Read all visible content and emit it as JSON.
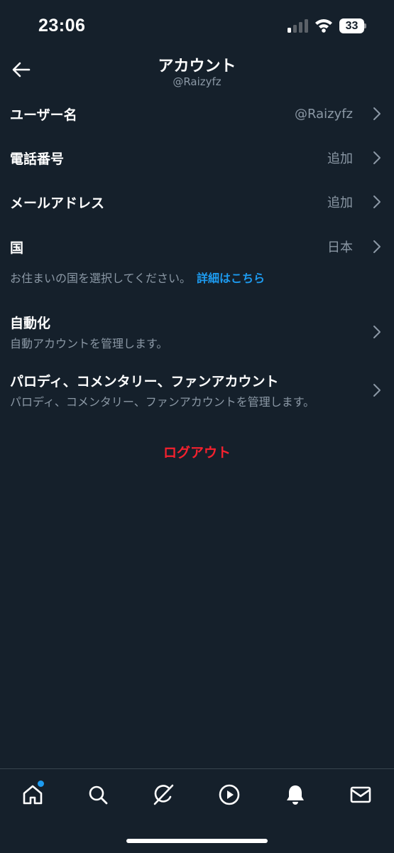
{
  "status_bar": {
    "time": "23:06",
    "battery_level": "33",
    "icons": [
      "signal-icon",
      "wifi-icon",
      "battery-icon"
    ]
  },
  "header": {
    "title": "アカウント",
    "subtitle": "@Raizyfz",
    "back_icon": "arrow-left-icon"
  },
  "rows": {
    "username": {
      "label": "ユーザー名",
      "value": "@Raizyfz"
    },
    "phone": {
      "label": "電話番号",
      "value": "追加"
    },
    "email": {
      "label": "メールアドレス",
      "value": "追加"
    },
    "country": {
      "label": "国",
      "value": "日本"
    }
  },
  "country_note": {
    "text": "お住まいの国を選択してください。",
    "link": "詳細はこちら"
  },
  "automation": {
    "title": "自動化",
    "description": "自動アカウントを管理します。"
  },
  "parody": {
    "title": "パロディ、コメンタリー、ファンアカウント",
    "description": "パロディ、コメンタリー、ファンアカウントを管理します。"
  },
  "logout_label": "ログアウト",
  "colors": {
    "background": "#15202b",
    "secondary_text": "#8b98a5",
    "link": "#1d9bf0",
    "danger": "#f4212e"
  },
  "bottom_nav": {
    "items": [
      "home-icon",
      "search-icon",
      "grok-icon",
      "play-icon",
      "bell-icon",
      "mail-icon"
    ],
    "home_has_badge": true
  }
}
